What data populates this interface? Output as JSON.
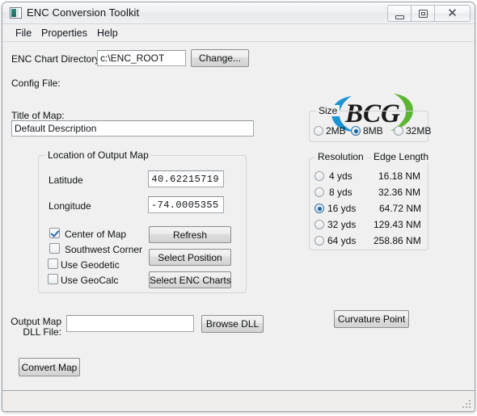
{
  "window": {
    "title": "ENC Conversion Toolkit",
    "icon": "app-icon",
    "controls": {
      "minimize": "minimize",
      "maximize": "maximize",
      "close": "✕"
    }
  },
  "menubar": {
    "items": [
      {
        "label": "File"
      },
      {
        "label": "Properties"
      },
      {
        "label": "Help"
      }
    ]
  },
  "form": {
    "enc_chart_directory_label": "ENC Chart Directory",
    "enc_chart_directory_value": "c:\\ENC_ROOT",
    "change_button": "Change...",
    "config_file_label": "Config File:",
    "config_file_value": "",
    "title_of_map_label": "Title of Map:",
    "title_of_map_value": "Default Description"
  },
  "location_group": {
    "legend": "Location of Output Map",
    "latitude_label": "Latitude",
    "latitude_value": "40.62215719",
    "longitude_label": "Longitude",
    "longitude_value": "-74.00053552",
    "checkboxes": [
      {
        "label": "Center of Map",
        "checked": true
      },
      {
        "label": "Southwest Corner",
        "checked": false
      },
      {
        "label": "Use Geodetic",
        "checked": false
      },
      {
        "label": "Use GeoCalc",
        "checked": false
      }
    ],
    "buttons": [
      {
        "label": "Refresh"
      },
      {
        "label": "Select Position"
      },
      {
        "label": "Select ENC Charts"
      }
    ]
  },
  "size_group": {
    "legend": "Size",
    "options": [
      {
        "label": "2MB",
        "selected": false
      },
      {
        "label": "8MB",
        "selected": true
      },
      {
        "label": "32MB",
        "selected": false
      }
    ]
  },
  "resolution_group": {
    "header_resolution": "Resolution",
    "header_edge_length": "Edge Length",
    "rows": [
      {
        "resolution": "4 yds",
        "edge_length": "16.18 NM",
        "selected": false
      },
      {
        "resolution": "8 yds",
        "edge_length": "32.36 NM",
        "selected": false
      },
      {
        "resolution": "16 yds",
        "edge_length": "64.72 NM",
        "selected": true
      },
      {
        "resolution": "32 yds",
        "edge_length": "129.43 NM",
        "selected": false
      },
      {
        "resolution": "64 yds",
        "edge_length": "258.86 NM",
        "selected": false
      }
    ]
  },
  "output": {
    "dll_label_line1": "Output Map",
    "dll_label_line2": "DLL File:",
    "dll_value": "",
    "browse_button": "Browse DLL",
    "convert_button": "Convert Map",
    "curvature_button": "Curvature Point"
  },
  "logo": {
    "text": "BCG",
    "blue": "#1b94d4",
    "green": "#5cb531",
    "text_color": "#1a1a1a"
  },
  "statusbar": {
    "text": ""
  }
}
